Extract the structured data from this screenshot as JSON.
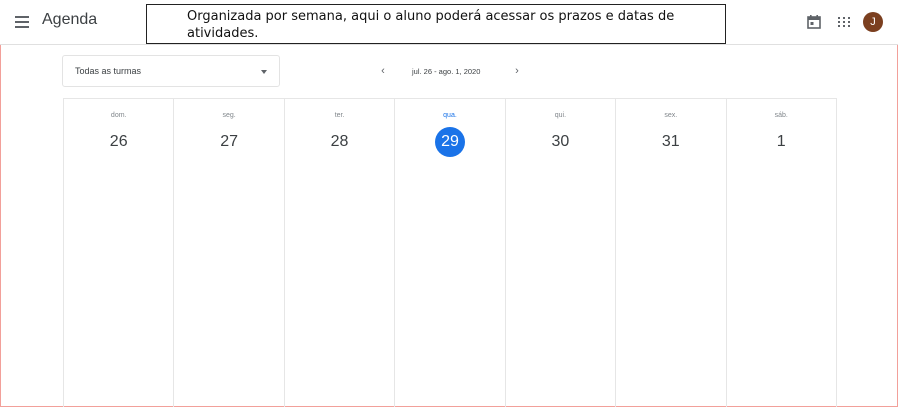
{
  "header": {
    "app_title": "Agenda",
    "callout_text": "Organizada por semana, aqui o aluno poderá acessar os prazos e datas de atividades.",
    "avatar_initial": "J",
    "icons": [
      "menu-icon",
      "calendar-icon",
      "apps-grid-icon"
    ]
  },
  "toolbar": {
    "class_filter": "Todas as turmas",
    "week_range": "jul. 26 - ago. 1, 2020",
    "prev_arrow": "‹",
    "next_arrow": "›"
  },
  "days": [
    {
      "name": "dom.",
      "num": "26"
    },
    {
      "name": "seg.",
      "num": "27"
    },
    {
      "name": "ter.",
      "num": "28"
    },
    {
      "name": "qua.",
      "num": "29"
    },
    {
      "name": "qui.",
      "num": "30"
    },
    {
      "name": "sex.",
      "num": "31"
    },
    {
      "name": "sáb.",
      "num": "1"
    }
  ],
  "colors": {
    "today_accent": "#1a73e8",
    "avatar_bg": "#7b3f1f"
  }
}
